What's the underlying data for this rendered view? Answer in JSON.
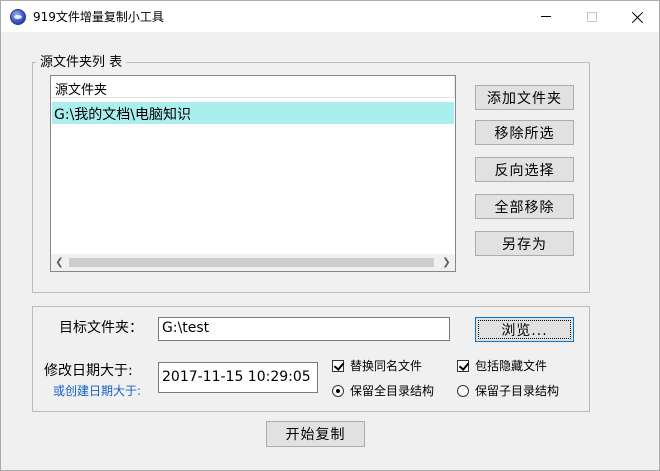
{
  "window": {
    "title": "919文件增量复制小工具"
  },
  "source_group": {
    "title": "源文件夹列 表",
    "list": {
      "columns": [
        "源文件夹"
      ],
      "rows": [
        {
          "path": "G:\\我的文档\\电脑知识",
          "selected": true
        }
      ]
    },
    "buttons": {
      "add": "添加文件夹",
      "remove_selected": "移除所选",
      "invert": "反向选择",
      "remove_all": "全部移除",
      "save_as": "另存为"
    }
  },
  "target_group": {
    "target_label": "目标文件夹：",
    "target_value": "G:\\test",
    "browse_label": "浏览...",
    "modified_label": "修改日期大于:",
    "created_label": "或创建日期大于:",
    "date_value": "2017-11-15 10:29:05",
    "options": {
      "replace_same_name": {
        "label": "替换同名文件",
        "checked": true
      },
      "include_hidden": {
        "label": "包括隐藏文件",
        "checked": true
      },
      "keep_full_structure": {
        "label": "保留全目录结构",
        "selected": true
      },
      "keep_sub_structure": {
        "label": "保留子目录结构",
        "selected": false
      }
    }
  },
  "start_button": "开始复制",
  "icons": {
    "app": "app-globe-icon",
    "minimize": "minimize-icon",
    "maximize": "maximize-icon",
    "close": "close-icon",
    "scroll_left": "chevron-left-icon",
    "scroll_right": "chevron-right-icon"
  },
  "colors": {
    "selection": "#aaeeee",
    "created_label": "#1060c8",
    "window_bg": "#f0f0f0"
  }
}
